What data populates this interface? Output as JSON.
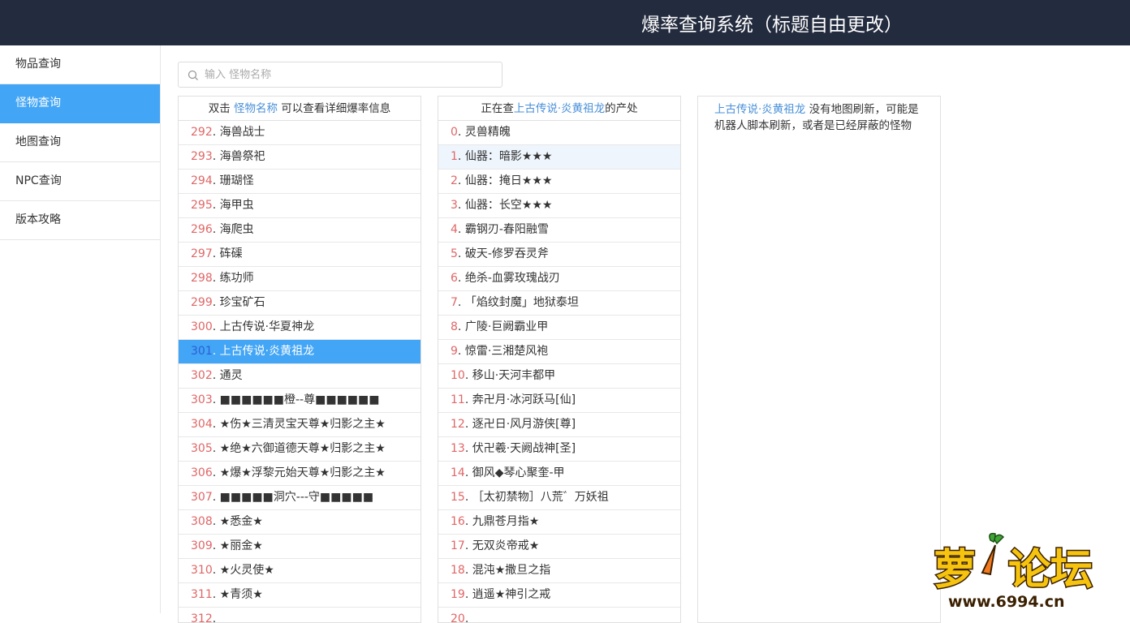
{
  "header": {
    "title": "爆率查询系统（标题自由更改）"
  },
  "sidebar": {
    "items": [
      {
        "label": "物品查询",
        "active": false
      },
      {
        "label": "怪物查询",
        "active": true
      },
      {
        "label": "地图查询",
        "active": false
      },
      {
        "label": "NPC查询",
        "active": false
      },
      {
        "label": "版本攻略",
        "active": false
      }
    ]
  },
  "search": {
    "placeholder": "输入 怪物名称",
    "value": ""
  },
  "monster_panel": {
    "head_prefix": "双击",
    "head_highlight": "怪物名称",
    "head_suffix": "可以查看详细爆率信息",
    "rows": [
      {
        "num": "292",
        "name": "海兽战士"
      },
      {
        "num": "293",
        "name": "海兽祭祀"
      },
      {
        "num": "294",
        "name": "珊瑚怪"
      },
      {
        "num": "295",
        "name": "海甲虫"
      },
      {
        "num": "296",
        "name": "海爬虫"
      },
      {
        "num": "297",
        "name": "砗磲"
      },
      {
        "num": "298",
        "name": "练功师"
      },
      {
        "num": "299",
        "name": "珍宝矿石"
      },
      {
        "num": "300",
        "name": "上古传说·华夏神龙"
      },
      {
        "num": "301",
        "name": "上古传说·炎黄祖龙",
        "selected": true
      },
      {
        "num": "302",
        "name": "通灵"
      },
      {
        "num": "303",
        "name": "■■■■■■橙--尊■■■■■■"
      },
      {
        "num": "304",
        "name": "★伤★三清灵宝天尊★归影之主★"
      },
      {
        "num": "305",
        "name": "★绝★六御道德天尊★归影之主★"
      },
      {
        "num": "306",
        "name": "★爆★浮黎元始天尊★归影之主★"
      },
      {
        "num": "307",
        "name": "■■■■■洞穴---守■■■■■"
      },
      {
        "num": "308",
        "name": "★悉金★"
      },
      {
        "num": "309",
        "name": "★丽金★"
      },
      {
        "num": "310",
        "name": "★火灵使★"
      },
      {
        "num": "311",
        "name": "★青须★"
      },
      {
        "num": "312",
        "name": ""
      }
    ]
  },
  "drop_panel": {
    "head_prefix": "正在查",
    "head_highlight": "上古传说·炎黄祖龙",
    "head_suffix": "的产处",
    "rows": [
      {
        "num": "0",
        "name": "灵兽精魄"
      },
      {
        "num": "1",
        "name": "仙器：暗影★★★",
        "hover": true
      },
      {
        "num": "2",
        "name": "仙器：掩日★★★"
      },
      {
        "num": "3",
        "name": "仙器：长空★★★"
      },
      {
        "num": "4",
        "name": "霸钢刃-春阳融雪"
      },
      {
        "num": "5",
        "name": "破天-修罗吞灵斧"
      },
      {
        "num": "6",
        "name": "绝杀-血雾玫瑰战刃"
      },
      {
        "num": "7",
        "name": "「焰纹封魔」地狱泰坦"
      },
      {
        "num": "8",
        "name": "广陵·巨阙霸业甲"
      },
      {
        "num": "9",
        "name": "惊雷·三湘楚风袍"
      },
      {
        "num": "10",
        "name": "移山·天河丰都甲"
      },
      {
        "num": "11",
        "name": "奔卍月·冰河跃马[仙]"
      },
      {
        "num": "12",
        "name": "逐卍日·风月游侠[尊]"
      },
      {
        "num": "13",
        "name": "伏卍羲·天阙战神[圣]"
      },
      {
        "num": "14",
        "name": "御风◆琴心聚奎-甲"
      },
      {
        "num": "15",
        "name": "［太初禁物］八荒゛万妖祖"
      },
      {
        "num": "16",
        "name": "九鼎苍月指★"
      },
      {
        "num": "17",
        "name": "无双炎帝戒★"
      },
      {
        "num": "18",
        "name": "混沌★撒旦之指"
      },
      {
        "num": "19",
        "name": "逍遥★神引之戒"
      },
      {
        "num": "20",
        "name": ""
      }
    ]
  },
  "map_panel": {
    "highlight": "上古传说·炎黄祖龙",
    "text": "没有地图刷新，可能是机器人脚本刷新，或者是已经屏蔽的怪物"
  },
  "watermark": {
    "text": "萝卜论坛",
    "url": "www.6994.cn"
  },
  "colors": {
    "header_bg": "#232b3e",
    "accent": "#42a5f5",
    "number_red": "#e06666",
    "link_blue": "#4a90d9"
  }
}
